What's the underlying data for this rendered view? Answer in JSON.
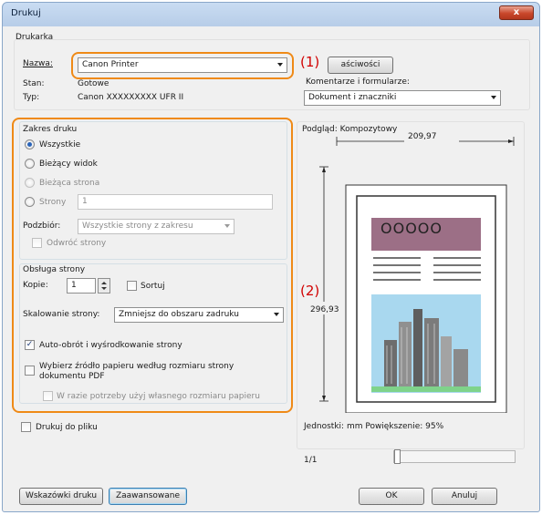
{
  "window": {
    "title": "Drukuj",
    "close_glyph": "x"
  },
  "printer": {
    "group_label": "Drukarka",
    "name_label": "Nazwa:",
    "name_value": "Canon Printer",
    "properties_button": "aściwości",
    "status_label": "Stan:",
    "status_value": "Gotowe",
    "type_label": "Typ:",
    "type_value": "Canon XXXXXXXXX UFR II"
  },
  "comments": {
    "label": "Komentarze i formularze:",
    "value": "Dokument i znaczniki"
  },
  "range": {
    "group_label": "Zakres druku",
    "all": "Wszystkie",
    "current_view": "Bieżący widok",
    "current_page": "Bieżąca strona",
    "pages": "Strony",
    "pages_value": "1",
    "subset_label": "Podzbiór:",
    "subset_value": "Wszystkie strony z zakresu",
    "reverse": "Odwróć strony"
  },
  "handling": {
    "group_label": "Obsługa strony",
    "copies_label": "Kopie:",
    "copies_value": "1",
    "collate": "Sortuj",
    "scaling_label": "Skalowanie strony:",
    "scaling_value": "Zmniejsz do obszaru zadruku",
    "autorotate": "Auto-obrót i wyśrodkowanie strony",
    "paper_source": "Wybierz źródło papieru według rozmiaru strony dokumentu PDF",
    "custom_paper": "W razie potrzeby użyj własnego rozmiaru papieru"
  },
  "print_to_file": "Drukuj do pliku",
  "preview": {
    "label": "Podgląd: Kompozytowy",
    "width": "209,97",
    "height": "296,93",
    "units_text": "Jednostki: mm Powiększenie:  95%",
    "page_counter": "1/1",
    "circles": "OOOOO"
  },
  "callouts": {
    "one": "(1)",
    "two": "(2)"
  },
  "buttons": {
    "tips": "Wskazówki druku",
    "advanced": "Zaawansowane",
    "ok": "OK",
    "cancel": "Anuluj"
  },
  "colors": {
    "callout_red": "#d10000",
    "highlight_orange": "#ef8a17",
    "banner_purple": "#9c6f86",
    "sky_blue": "#a9d8ef",
    "grass_green": "#7fd38a"
  }
}
